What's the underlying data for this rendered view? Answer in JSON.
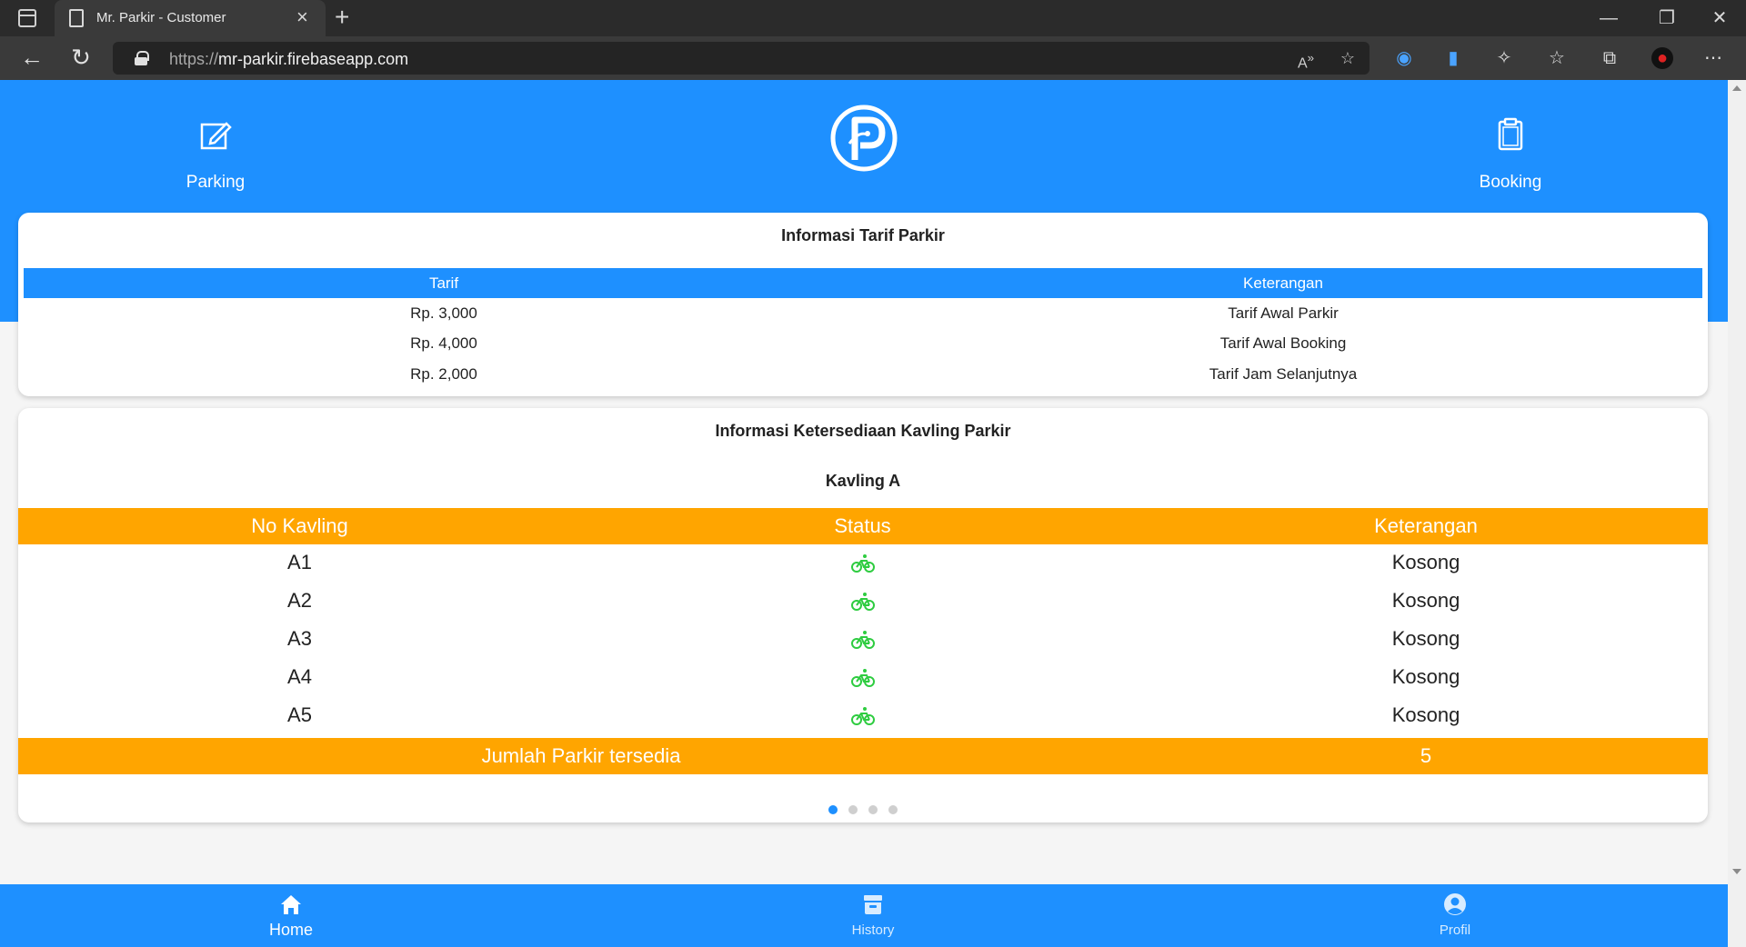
{
  "browser": {
    "tab_title": "Mr. Parkir - Customer",
    "tab_close": "×",
    "new_tab": "+",
    "url_scheme": "https://",
    "url_host": "mr-parkir.firebaseapp.com",
    "window_minimize": "—",
    "window_restore": "❐",
    "window_close": "✕"
  },
  "top_nav": {
    "parking_label": "Parking",
    "booking_label": "Booking",
    "logo_icon": "parking-logo-icon"
  },
  "tarif": {
    "title": "Informasi Tarif Parkir",
    "headers": [
      "Tarif",
      "Keterangan"
    ],
    "rows": [
      {
        "tarif": "Rp. 3,000",
        "keterangan": "Tarif Awal Parkir"
      },
      {
        "tarif": "Rp. 4,000",
        "keterangan": "Tarif Awal Booking"
      },
      {
        "tarif": "Rp. 2,000",
        "keterangan": "Tarif Jam Selanjutnya"
      }
    ]
  },
  "kavling": {
    "title": "Informasi Ketersediaan Kavling Parkir",
    "section": "Kavling A",
    "headers": [
      "No Kavling",
      "Status",
      "Keterangan"
    ],
    "rows": [
      {
        "no": "A1",
        "status_icon": "bike-icon",
        "keterangan": "Kosong"
      },
      {
        "no": "A2",
        "status_icon": "bike-icon",
        "keterangan": "Kosong"
      },
      {
        "no": "A3",
        "status_icon": "bike-icon",
        "keterangan": "Kosong"
      },
      {
        "no": "A4",
        "status_icon": "bike-icon",
        "keterangan": "Kosong"
      },
      {
        "no": "A5",
        "status_icon": "bike-icon",
        "keterangan": "Kosong"
      }
    ],
    "footer_label": "Jumlah Parkir tersedia",
    "footer_value": "5",
    "pagination": {
      "active": 1,
      "total": 4
    }
  },
  "bottom_nav": {
    "items": [
      {
        "label": "Home",
        "icon": "home-icon",
        "active": true
      },
      {
        "label": "History",
        "icon": "archive-icon",
        "active": false
      },
      {
        "label": "Profil",
        "icon": "user-icon",
        "active": false
      }
    ]
  },
  "colors": {
    "primary": "#1e90ff",
    "accent": "#ffa500",
    "status_available": "#2ecc40"
  }
}
